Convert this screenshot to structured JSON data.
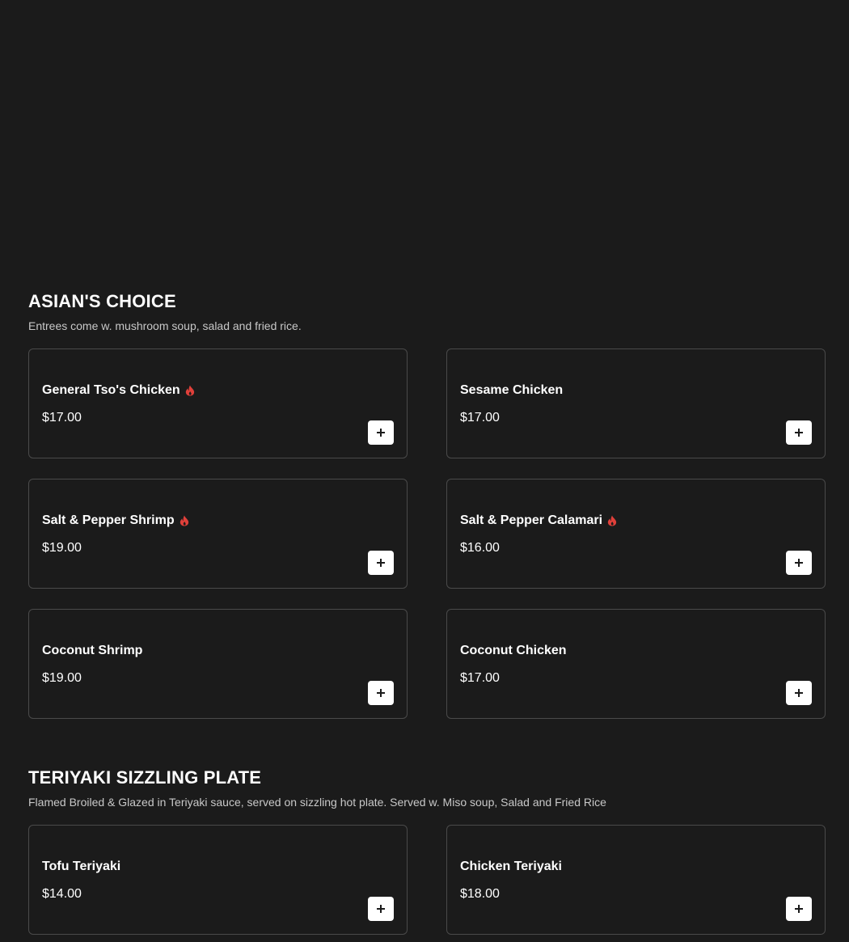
{
  "sections": [
    {
      "title": "ASIAN'S CHOICE",
      "description": "Entrees come w. mushroom soup, salad and fried rice.",
      "items": [
        {
          "name": "General Tso's Chicken",
          "price": "$17.00",
          "spicy": true
        },
        {
          "name": "Sesame Chicken",
          "price": "$17.00",
          "spicy": false
        },
        {
          "name": "Salt & Pepper Shrimp",
          "price": "$19.00",
          "spicy": true
        },
        {
          "name": "Salt & Pepper Calamari",
          "price": "$16.00",
          "spicy": true
        },
        {
          "name": "Coconut Shrimp",
          "price": "$19.00",
          "spicy": false
        },
        {
          "name": "Coconut Chicken",
          "price": "$17.00",
          "spicy": false
        }
      ]
    },
    {
      "title": "TERIYAKI SIZZLING PLATE",
      "description": "Flamed Broiled & Glazed in Teriyaki sauce, served on sizzling hot plate. Served w. Miso soup, Salad and Fried Rice",
      "items": [
        {
          "name": "Tofu Teriyaki",
          "price": "$14.00",
          "spicy": false
        },
        {
          "name": "Chicken Teriyaki",
          "price": "$18.00",
          "spicy": false
        }
      ]
    }
  ],
  "icons": {
    "spicy": "flame-icon",
    "add": "plus-icon"
  },
  "colors": {
    "background": "#1b1b1b",
    "card_border": "#4a4a4a",
    "spicy": "#e0403a",
    "button": "#ffffff"
  }
}
